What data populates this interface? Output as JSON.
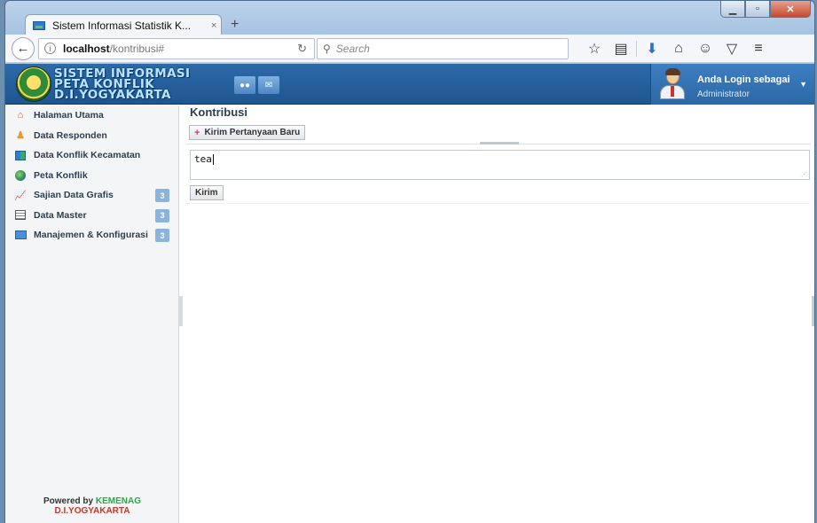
{
  "browser": {
    "tab_title": "Sistem Informasi Statistik K...",
    "tab_close": "×",
    "new_tab": "+",
    "window_buttons": {
      "minimize": "▁",
      "maximize": "▫",
      "close": "✕"
    },
    "url_host": "localhost",
    "url_path": "/kontribusi#",
    "search_placeholder": "Search"
  },
  "header": {
    "brand_line1": "SISTEM INFORMASI",
    "brand_line2": "PETA KONFLIK",
    "brand_line3": "D.I.YOGYAKARTA",
    "user_label": "Anda Login sebagai",
    "user_role": "Administrator"
  },
  "sidebar": {
    "items": [
      {
        "label": "Halaman Utama",
        "icon": "home-icon"
      },
      {
        "label": "Data Responden",
        "icon": "users-icon"
      },
      {
        "label": "Data Konflik Kecamatan",
        "icon": "grid-icon"
      },
      {
        "label": "Peta Konflik",
        "icon": "globe-icon"
      },
      {
        "label": "Sajian Data Grafis",
        "icon": "chart-icon",
        "badge": "3"
      },
      {
        "label": "Data Master",
        "icon": "table-icon",
        "badge": "3"
      },
      {
        "label": "Manajemen & Konfigurasi",
        "icon": "monitor-icon",
        "badge": "3"
      }
    ],
    "powered_prefix": "Powered by",
    "powered_org": "KEMENAG",
    "powered_region": "D.I.YOGYAKARTA"
  },
  "main": {
    "title": "Kontribusi",
    "new_question_label": "Kirim Pertanyaan Baru",
    "message_value": "tea",
    "send_label": "Kirim"
  }
}
